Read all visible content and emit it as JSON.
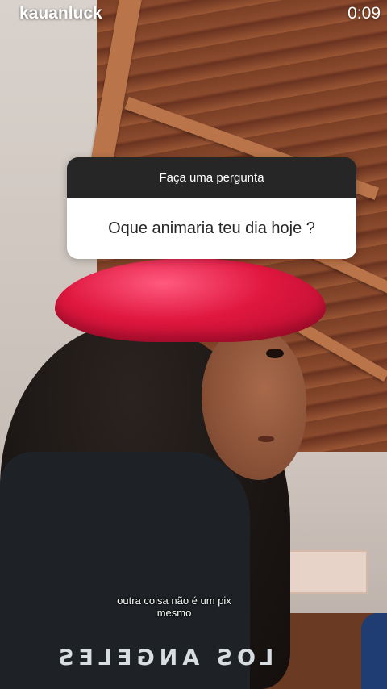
{
  "header": {
    "username": "kauanluck",
    "timer": "0:09"
  },
  "question_sticker": {
    "prompt": "Faça uma pergunta",
    "question": "Oque animaria teu dia hoje ?"
  },
  "caption": {
    "line1": "outra coisa não é um pix",
    "line2": "mesmo"
  },
  "shirt_print": "LOS ANGELES",
  "colors": {
    "sticker_header": "#262626",
    "sticker_body": "#ffffff",
    "cap": "#e0173f"
  }
}
